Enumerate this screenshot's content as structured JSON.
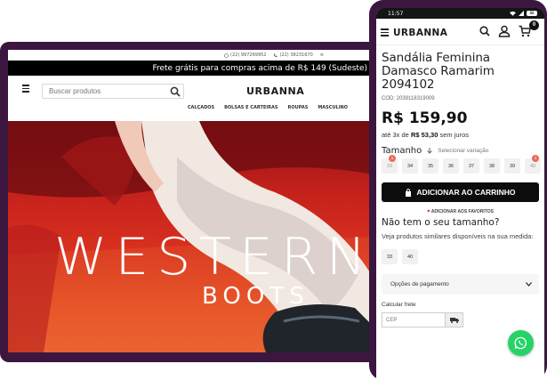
{
  "desktop": {
    "topbar": {
      "phone1": "(22) 997269952",
      "phone2": "(22) 38231670",
      "menu_glyph": "≡"
    },
    "promo": "Frete grátis para compras acima de R$ 149 (Sudeste)",
    "search": {
      "placeholder": "Buscar produtos"
    },
    "logo": "URBANNA",
    "nav": [
      "CALÇADOS",
      "BOLSAS E CARTEIRAS",
      "ROUPAS",
      "MASCULINO"
    ],
    "hero": {
      "title": "WESTERN",
      "subtitle": "BOOTS"
    }
  },
  "phone": {
    "status": {
      "time": "11:57",
      "battery": "88"
    },
    "logo": "URBANNA",
    "cart_count": "0",
    "product": {
      "title": "Sandália Feminina Damasco Ramarim 2094102",
      "sku": "COD: 2039118319009",
      "price": "R$ 159,90",
      "installments_prefix": "até 3x de",
      "installments_value": "R$ 53,30",
      "installments_suffix": "sem juros"
    },
    "size_label": "Tamanho",
    "size_hint": "Selecionar variação",
    "sizes": [
      {
        "label": "33",
        "badge": "1"
      },
      {
        "label": "34"
      },
      {
        "label": "35"
      },
      {
        "label": "36"
      },
      {
        "label": "37"
      },
      {
        "label": "38"
      },
      {
        "label": "39"
      },
      {
        "label": "40",
        "badge": "1"
      }
    ],
    "add_to_cart": "ADICIONAR AO CARRINHO",
    "favorites": "ADICIONAR AOS FAVORITOS",
    "no_size_title": "Não tem o seu tamanho?",
    "no_size_desc": "Veja produtos similares disponíveis na sua medida:",
    "similar_sizes": [
      "33",
      "40"
    ],
    "payment_options": "Opções de pagamento",
    "calc_freight": "Calcular frete",
    "cep_placeholder": "CEP"
  },
  "colors": {
    "frame": "#3b1740",
    "whatsapp": "#25d366",
    "badge": "#ec6a5f"
  }
}
